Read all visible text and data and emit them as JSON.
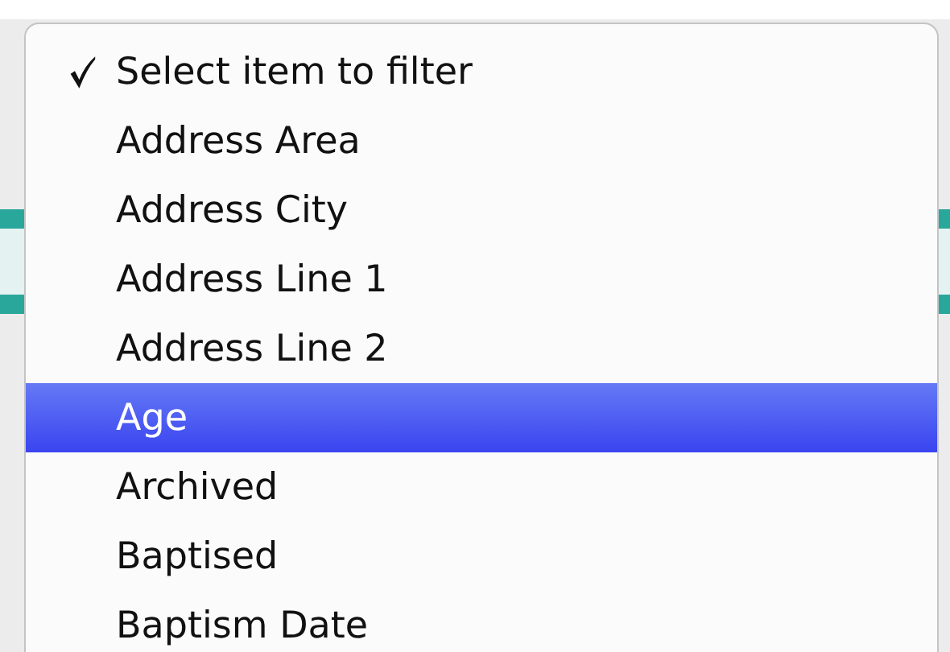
{
  "menu": {
    "items": [
      {
        "label": "Select item to filter",
        "checked": true,
        "selected": false
      },
      {
        "label": "Address Area",
        "checked": false,
        "selected": false
      },
      {
        "label": "Address City",
        "checked": false,
        "selected": false
      },
      {
        "label": "Address Line 1",
        "checked": false,
        "selected": false
      },
      {
        "label": "Address Line 2",
        "checked": false,
        "selected": false
      },
      {
        "label": "Age",
        "checked": false,
        "selected": true
      },
      {
        "label": "Archived",
        "checked": false,
        "selected": false
      },
      {
        "label": "Baptised",
        "checked": false,
        "selected": false
      },
      {
        "label": "Baptism Date",
        "checked": false,
        "selected": false
      }
    ]
  }
}
